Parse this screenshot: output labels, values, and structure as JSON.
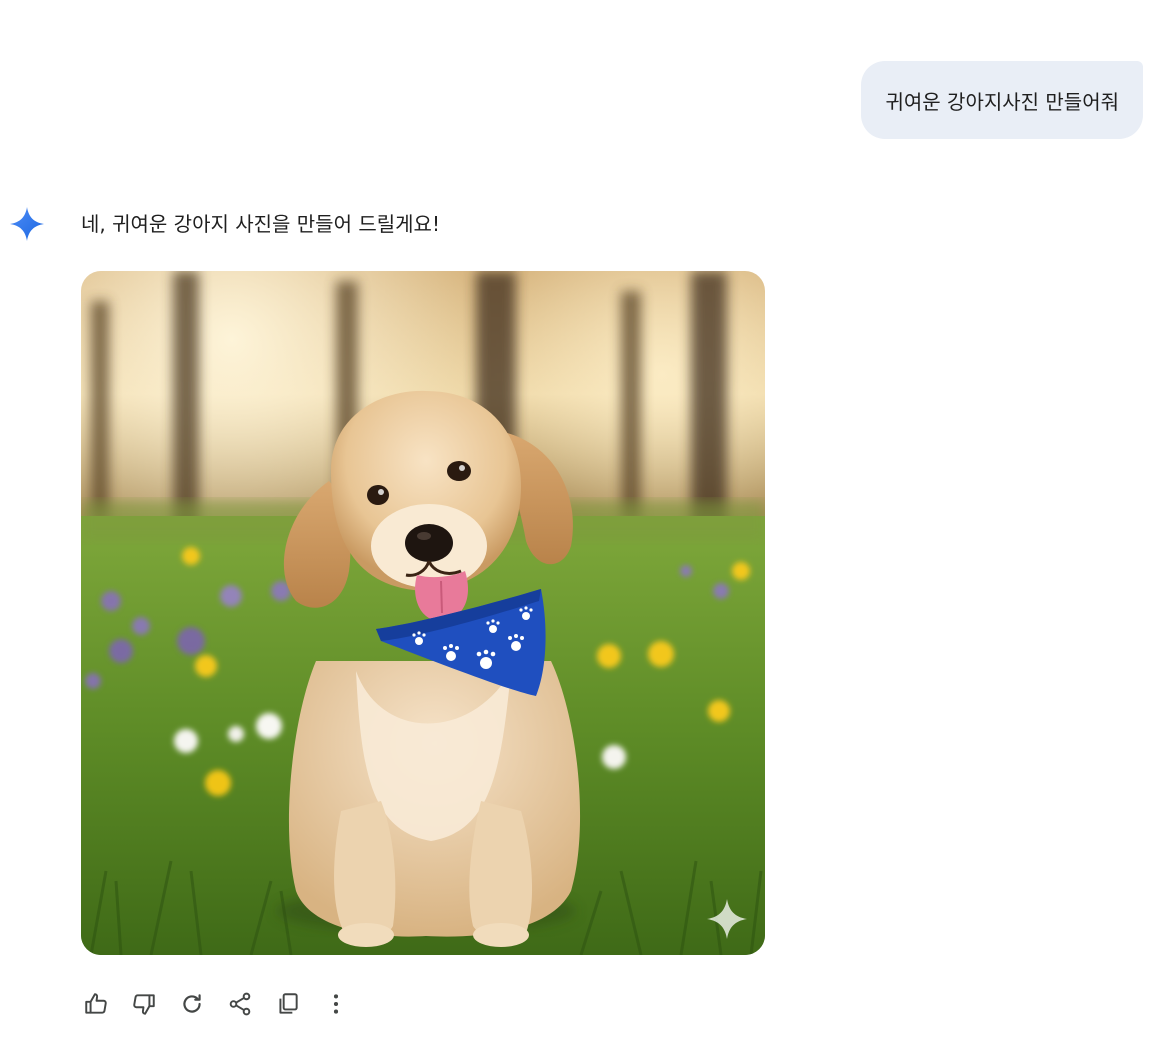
{
  "conversation": {
    "user_message": "귀여운 강아지사진 만들어줘",
    "assistant_message": "네, 귀여운 강아지 사진을 만들어 드릴게요!"
  },
  "generated_image": {
    "subject": "golden-retriever-puppy-with-blue-paw-print-bandana-in-meadow"
  },
  "actions": [
    {
      "icon": "thumbs-up-icon"
    },
    {
      "icon": "thumbs-down-icon"
    },
    {
      "icon": "regenerate-icon"
    },
    {
      "icon": "share-icon"
    },
    {
      "icon": "copy-icon"
    },
    {
      "icon": "more-vertical-icon"
    }
  ],
  "colors": {
    "user_bubble": "#e9eef6",
    "icon": "#444746",
    "spark_start": "#4285f4",
    "spark_end": "#1a73e8"
  }
}
